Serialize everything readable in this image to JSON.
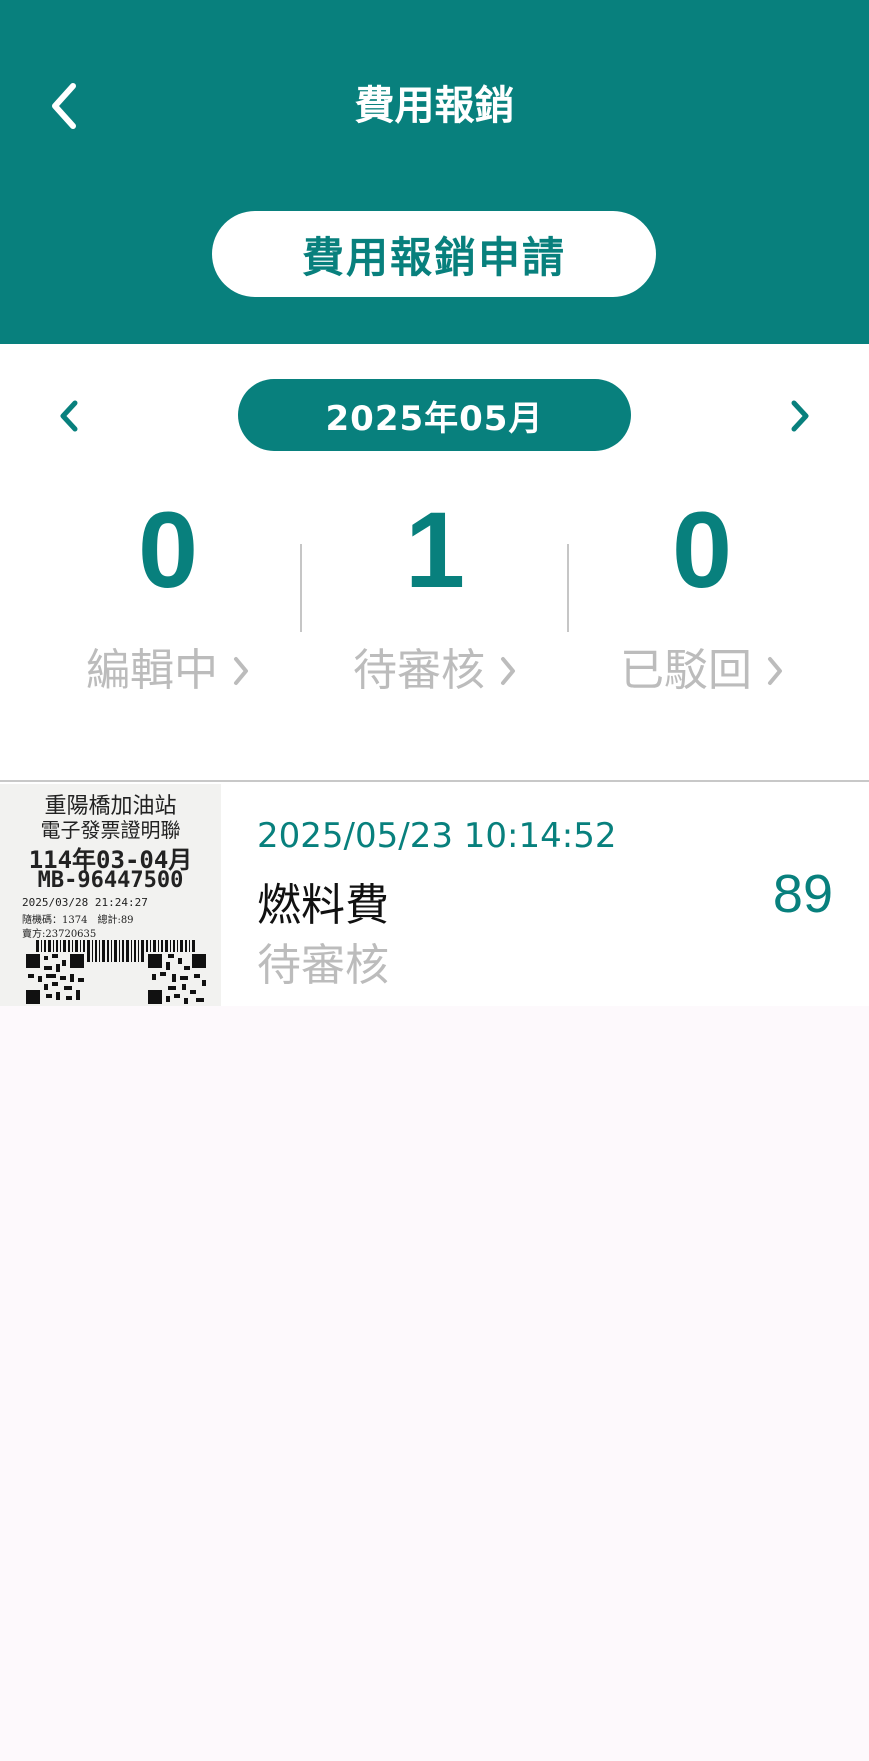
{
  "header": {
    "title": "費用報銷",
    "back_icon": "chevron-left-icon",
    "apply_button_label": "費用報銷申請",
    "background_color": "#08807d"
  },
  "month_selector": {
    "current": "2025年05月",
    "prev_icon": "chevron-left-icon",
    "next_icon": "chevron-right-icon"
  },
  "stats": [
    {
      "count": "0",
      "label": "編輯中",
      "icon": "chevron-right-icon"
    },
    {
      "count": "1",
      "label": "待審核",
      "icon": "chevron-right-icon"
    },
    {
      "count": "0",
      "label": "已駁回",
      "icon": "chevron-right-icon"
    }
  ],
  "records": [
    {
      "datetime": "2025/05/23 10:14:52",
      "category": "燃料費",
      "status": "待審核",
      "amount": "89",
      "receipt": {
        "lines": [
          "重陽橋加油站",
          "電子發票證明聯",
          "114年03-04月",
          "MB-96447500",
          "2025/03/28 21:24:27",
          "隨機碼：1374　總計:89",
          "賣方:23720635"
        ]
      }
    }
  ]
}
